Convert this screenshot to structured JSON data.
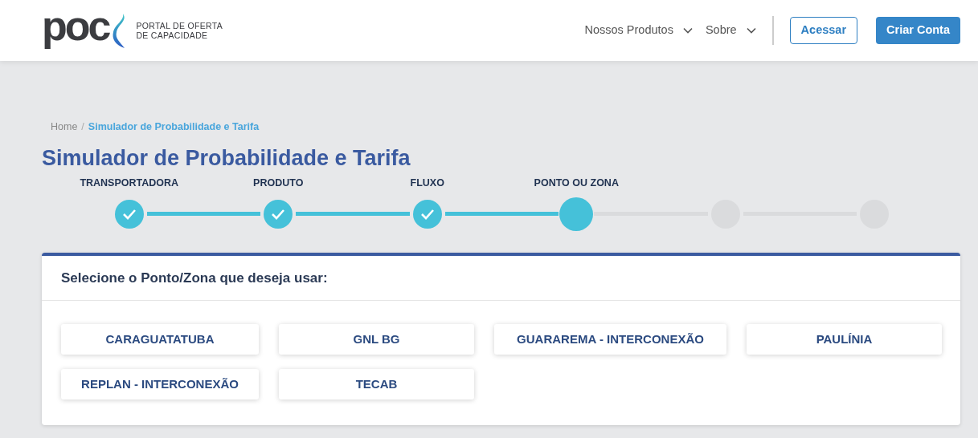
{
  "header": {
    "logo": {
      "mark": "poc",
      "tagline_1": "PORTAL DE OFERTA",
      "tagline_2": "DE CAPACIDADE"
    },
    "nav": [
      {
        "label": "Nossos Produtos"
      },
      {
        "label": "Sobre"
      }
    ],
    "login_button": "Acessar",
    "signup_button": "Criar Conta"
  },
  "breadcrumb": {
    "separator": "/",
    "items": [
      {
        "label": "Home",
        "current": false
      },
      {
        "label": "Simulador de Probabilidade e Tarifa",
        "current": true
      }
    ]
  },
  "title": "Simulador de Probabilidade e Tarifa",
  "steps": [
    {
      "label": "TRANSPORTADORA",
      "completed": true,
      "current": false
    },
    {
      "label": "PRODUTO",
      "completed": true,
      "current": false
    },
    {
      "label": "FLUXO",
      "completed": true,
      "current": false
    },
    {
      "label": "PONTO OU ZONA",
      "completed": false,
      "current": true
    },
    {
      "completed": false,
      "current": false
    },
    {
      "completed": false,
      "current": false
    }
  ],
  "panel": {
    "heading": "Selecione o Ponto/Zona que deseja usar:",
    "options": [
      "CARAGUATATUBA",
      "GNL BG",
      "GUARAREMA - INTERCONEXÃO",
      "PAULÍNIA",
      "REPLAN - INTERCONEXÃO",
      "TECAB"
    ]
  }
}
